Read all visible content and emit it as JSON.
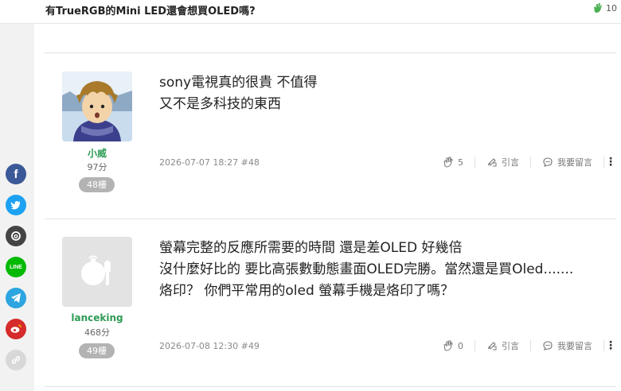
{
  "header": {
    "title": "有TrueRGB的Mini LED還會想買OLED嗎?",
    "clap_count": "10"
  },
  "social": [
    {
      "name": "facebook",
      "label": "f",
      "color": "#3b5998"
    },
    {
      "name": "twitter",
      "label": "",
      "color": "#1da1f2"
    },
    {
      "name": "threads",
      "label": "",
      "color": "#444444"
    },
    {
      "name": "line",
      "label": "LINE",
      "color": "#00b900"
    },
    {
      "name": "telegram",
      "label": "",
      "color": "#2ca5e0"
    },
    {
      "name": "weibo",
      "label": "",
      "color": "#d52b2b"
    },
    {
      "name": "link",
      "label": "",
      "color": "#d8d8d8"
    }
  ],
  "posts": [
    {
      "username": "小威",
      "points": "97分",
      "floor": "48樓",
      "lines": [
        "sony電視真的很貴 不值得",
        "又不是多科技的東西"
      ],
      "meta": "2026-07-07 18:27 #48",
      "likes": "5",
      "quote_label": "引言",
      "reply_label": "我要留言"
    },
    {
      "username": "lanceking",
      "points": "468分",
      "floor": "49樓",
      "lines": [
        "螢幕完整的反應所需要的時間 還是差OLED 好幾倍",
        "沒什麼好比的 要比高張數動態畫面OLED完勝。當然還是買Oled.......",
        "烙印？ 你們平常用的oled 螢幕手機是烙印了嗎？"
      ],
      "meta": "2026-07-08 12:30 #49",
      "likes": "0",
      "quote_label": "引言",
      "reply_label": "我要留言"
    }
  ]
}
